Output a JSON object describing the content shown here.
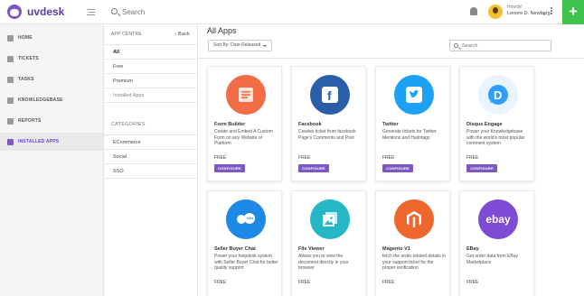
{
  "brand": {
    "name": "uvdesk"
  },
  "topbar": {
    "search_placeholder": "Search",
    "howdy": "Howdy!",
    "user_name": "Lenore D. Newberg",
    "add_label": "+"
  },
  "sidebar": {
    "items": [
      {
        "label": "HOME"
      },
      {
        "label": "TICKETS"
      },
      {
        "label": "TASKS"
      },
      {
        "label": "KNOWLEDGEBASE"
      },
      {
        "label": "REPORTS"
      },
      {
        "label": "INSTALLED APPS"
      }
    ]
  },
  "app_centre": {
    "title": "APP CENTRE",
    "back_label": "‹ Back",
    "filters": [
      "All",
      "Free",
      "Premium",
      "Installed Apps"
    ],
    "categories_title": "CATEGORIES",
    "categories": [
      "ECommerce",
      "Social",
      "SSO"
    ]
  },
  "main": {
    "title": "All Apps",
    "sort_label": "Sort By: Date Released",
    "search_placeholder": "Search"
  },
  "apps": [
    {
      "name": "Form Builder",
      "desc": "Create and Embed A Custom Form on any Website or Platform",
      "price": "FREE",
      "button": "CONFIGURE",
      "icon": "form-builder-icon",
      "color": "#f26d46"
    },
    {
      "name": "Facebook",
      "desc": "Creates ticket from facebook Page's Comments and Post",
      "price": "FREE",
      "button": "CONFIGURE",
      "icon": "facebook-icon",
      "color": "#2b5ea8"
    },
    {
      "name": "Twitter",
      "desc": "Generate tickets for Twitter Mentions and Hashtags",
      "price": "FREE",
      "button": "CONFIGURE",
      "icon": "twitter-icon",
      "color": "#1da1f2"
    },
    {
      "name": "Disqus Engage",
      "desc": "Power your Knowledgebase with the world's most popular comment system",
      "price": "FREE",
      "button": "CONFIGURE",
      "icon": "disqus-icon",
      "color": "#2e9fff"
    },
    {
      "name": "Seller Buyer Chat",
      "desc": "Power your helpdesk system with Seller Buyer Chat for better quality support",
      "price": "FREE",
      "icon": "chat-icon",
      "color": "#1e88e5"
    },
    {
      "name": "File Viewer",
      "desc": "Allows you to view the document directly in your browser",
      "price": "FREE",
      "icon": "file-viewer-icon",
      "color": "#26b7c6"
    },
    {
      "name": "Magento V1",
      "desc": "fetch the order related details in your support ticket for the proper verification",
      "price": "FREE",
      "icon": "magento-icon",
      "color": "#ee672f"
    },
    {
      "name": "EBay",
      "desc": "Get order data from EBay Marketplace",
      "price": "FREE",
      "icon": "ebay-icon",
      "color": "#7e4bd4"
    }
  ],
  "glyphs": {
    "facebook": "f",
    "ebay": "ebay",
    "disqus": "D"
  }
}
